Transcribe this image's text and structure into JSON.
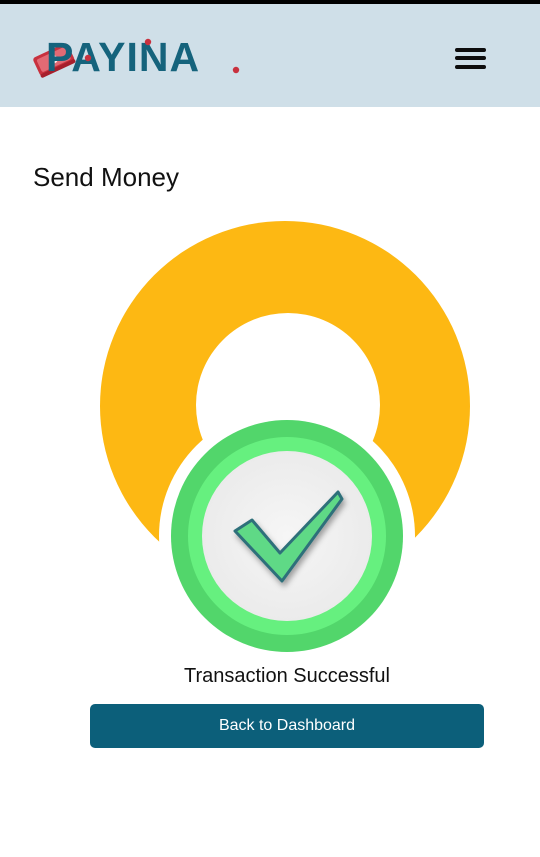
{
  "header": {
    "logo_text": "PAYINA",
    "menu_icon": "hamburger-menu-icon"
  },
  "main": {
    "title": "Send Money",
    "illustration_icon": "success-check-icon",
    "status_message": "Transaction Successful",
    "back_button_label": "Back to Dashboard"
  },
  "colors": {
    "header_bg": "#cfdfe8",
    "brand_blue": "#15637c",
    "brand_red": "#c8313e",
    "accent_yellow": "#fdb813",
    "success_green": "#52d66b",
    "button_bg": "#0c5f7a"
  }
}
